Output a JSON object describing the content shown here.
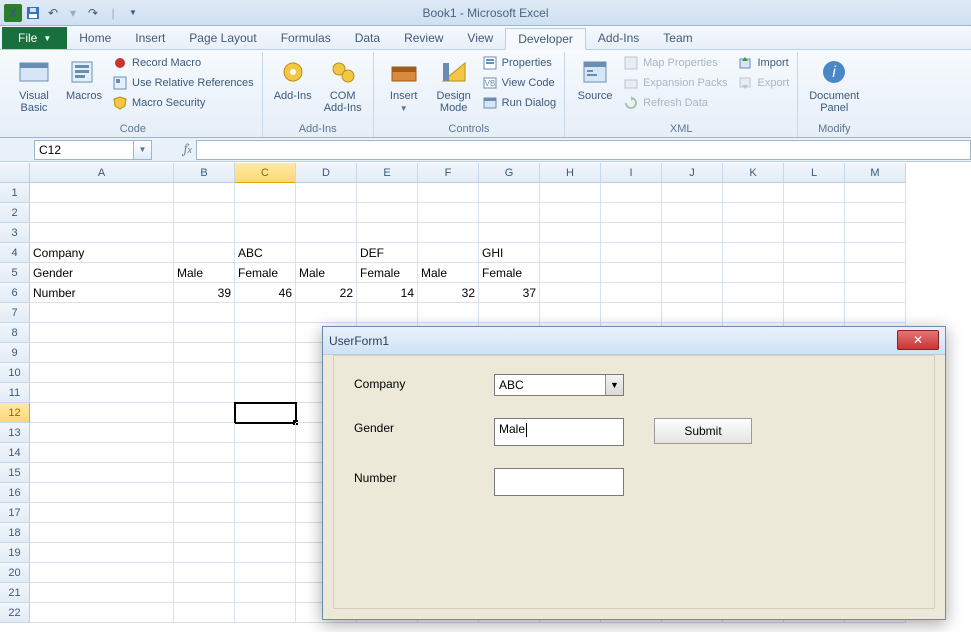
{
  "app_title": "Book1 - Microsoft Excel",
  "qat": {
    "save": "save",
    "undo": "undo",
    "redo": "redo"
  },
  "tabs": {
    "file": "File",
    "home": "Home",
    "insert": "Insert",
    "page_layout": "Page Layout",
    "formulas": "Formulas",
    "data": "Data",
    "review": "Review",
    "view": "View",
    "developer": "Developer",
    "addins": "Add-Ins",
    "team": "Team"
  },
  "ribbon": {
    "code": {
      "label": "Code",
      "visual_basic": "Visual\nBasic",
      "macros": "Macros",
      "record_macro": "Record Macro",
      "use_relative": "Use Relative References",
      "macro_security": "Macro Security"
    },
    "addins": {
      "label": "Add-Ins",
      "addins": "Add-Ins",
      "com": "COM\nAdd-Ins"
    },
    "controls": {
      "label": "Controls",
      "insert": "Insert",
      "design": "Design\nMode",
      "properties": "Properties",
      "view_code": "View Code",
      "run_dialog": "Run Dialog"
    },
    "xml": {
      "label": "XML",
      "source": "Source",
      "map_props": "Map Properties",
      "expansion": "Expansion Packs",
      "refresh": "Refresh Data",
      "import": "Import",
      "export": "Export"
    },
    "modify": {
      "label": "Modify",
      "doc_panel": "Document\nPanel"
    }
  },
  "name_box": "C12",
  "columns": [
    "A",
    "B",
    "C",
    "D",
    "E",
    "F",
    "G",
    "H",
    "I",
    "J",
    "K",
    "L",
    "M"
  ],
  "selected_col": "C",
  "selected_row": 12,
  "sheet": {
    "r4": {
      "A": "Company",
      "C": "ABC",
      "E": "DEF",
      "G": "GHI"
    },
    "r5": {
      "A": "Gender",
      "B": "Male",
      "C": "Female",
      "D": "Male",
      "E": "Female",
      "F": "Male",
      "G": "Female"
    },
    "r6": {
      "A": "Number",
      "B": "39",
      "C": "46",
      "D": "22",
      "E": "14",
      "F": "32",
      "G": "37"
    }
  },
  "userform": {
    "title": "UserForm1",
    "company_lab": "Company",
    "company_val": "ABC",
    "gender_lab": "Gender",
    "gender_val": "Male",
    "number_lab": "Number",
    "number_val": "",
    "submit": "Submit"
  }
}
